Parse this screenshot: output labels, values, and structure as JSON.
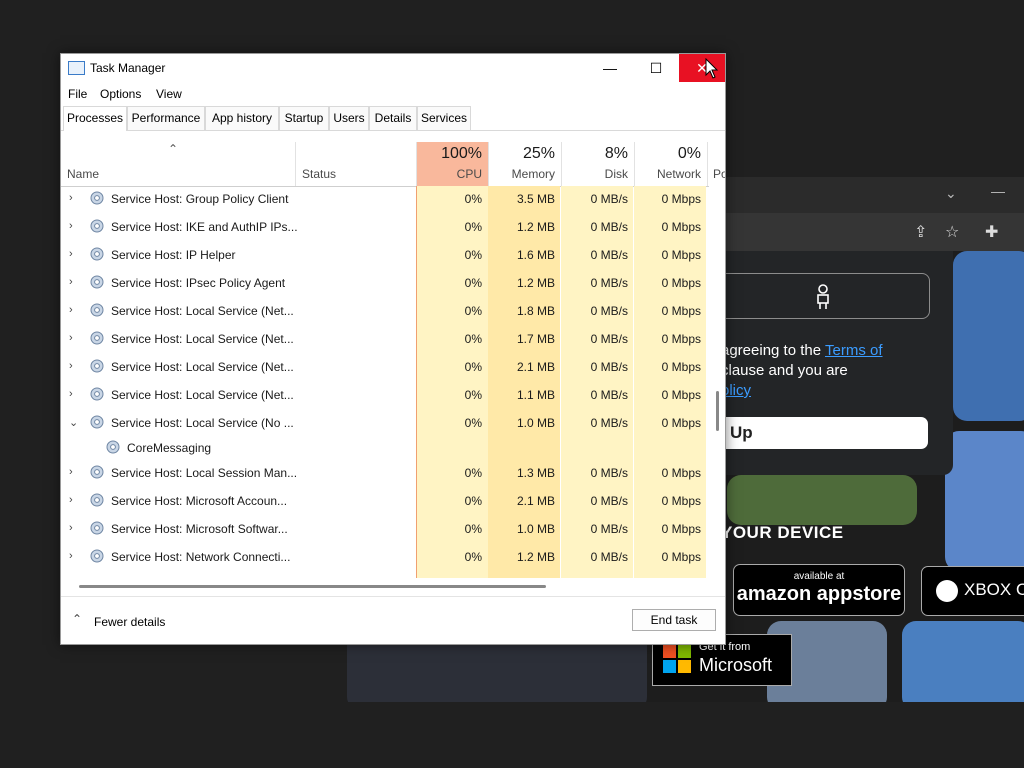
{
  "browser": {
    "agree_line1": "agreeing to the ",
    "terms_link": "Terms of",
    "agree_line2": "clause and you are",
    "policy_link": "olicy",
    "signup_label": "Up",
    "device_heading": "YOUR DEVICE",
    "appstore_small": "available at",
    "appstore_big": "amazon appstore",
    "xbox_text": "XBOX O",
    "ms_small": "Get it from",
    "ms_big": "Microsoft"
  },
  "taskmanager": {
    "title": "Task Manager",
    "close_glyph": "✕",
    "minimize_glyph": "—",
    "maximize_glyph": "☐",
    "menu": [
      "File",
      "Options",
      "View"
    ],
    "tabs": [
      "Processes",
      "Performance",
      "App history",
      "Startup",
      "Users",
      "Details",
      "Services"
    ],
    "active_tab": "Processes",
    "columns": {
      "name": "Name",
      "status": "Status",
      "cpu_pct": "100%",
      "cpu": "CPU",
      "memory_pct": "25%",
      "memory": "Memory",
      "disk_pct": "8%",
      "disk": "Disk",
      "network_pct": "0%",
      "network": "Network",
      "power_partial": "Po"
    },
    "rows": [
      {
        "name": "Service Host: Group Policy Client",
        "expander": "›",
        "cpu": "0%",
        "memory": "3.5 MB",
        "disk": "0 MB/s",
        "network": "0 Mbps"
      },
      {
        "name": "Service Host: IKE and AuthIP IPs...",
        "expander": "›",
        "cpu": "0%",
        "memory": "1.2 MB",
        "disk": "0 MB/s",
        "network": "0 Mbps"
      },
      {
        "name": "Service Host: IP Helper",
        "expander": "›",
        "cpu": "0%",
        "memory": "1.6 MB",
        "disk": "0 MB/s",
        "network": "0 Mbps"
      },
      {
        "name": "Service Host: IPsec Policy Agent",
        "expander": "›",
        "cpu": "0%",
        "memory": "1.2 MB",
        "disk": "0 MB/s",
        "network": "0 Mbps"
      },
      {
        "name": "Service Host: Local Service (Net...",
        "expander": "›",
        "cpu": "0%",
        "memory": "1.8 MB",
        "disk": "0 MB/s",
        "network": "0 Mbps"
      },
      {
        "name": "Service Host: Local Service (Net...",
        "expander": "›",
        "cpu": "0%",
        "memory": "1.7 MB",
        "disk": "0 MB/s",
        "network": "0 Mbps"
      },
      {
        "name": "Service Host: Local Service (Net...",
        "expander": "›",
        "cpu": "0%",
        "memory": "2.1 MB",
        "disk": "0 MB/s",
        "network": "0 Mbps"
      },
      {
        "name": "Service Host: Local Service (Net...",
        "expander": "›",
        "cpu": "0%",
        "memory": "1.1 MB",
        "disk": "0 MB/s",
        "network": "0 Mbps"
      },
      {
        "name": "Service Host: Local Service (No ...",
        "expander": "⌄",
        "cpu": "0%",
        "memory": "1.0 MB",
        "disk": "0 MB/s",
        "network": "0 Mbps"
      },
      {
        "name": "Service Host: Local Session Man...",
        "expander": "›",
        "cpu": "0%",
        "memory": "1.3 MB",
        "disk": "0 MB/s",
        "network": "0 Mbps"
      },
      {
        "name": "Service Host: Microsoft Accoun...",
        "expander": "›",
        "cpu": "0%",
        "memory": "2.1 MB",
        "disk": "0 MB/s",
        "network": "0 Mbps"
      },
      {
        "name": "Service Host: Microsoft Softwar...",
        "expander": "›",
        "cpu": "0%",
        "memory": "1.0 MB",
        "disk": "0 MB/s",
        "network": "0 Mbps"
      },
      {
        "name": "Service Host: Network Connecti...",
        "expander": "›",
        "cpu": "0%",
        "memory": "1.2 MB",
        "disk": "0 MB/s",
        "network": "0 Mbps"
      }
    ],
    "child_row": {
      "name": "CoreMessaging"
    },
    "footer": {
      "fewer_icon_glyph": "⌃",
      "fewer_details": "Fewer details",
      "end_task": "End task"
    },
    "colors": {
      "cpu_highlight": "#f9b89c",
      "column_tint": "#fff4c4",
      "close_red": "#e81123"
    }
  }
}
